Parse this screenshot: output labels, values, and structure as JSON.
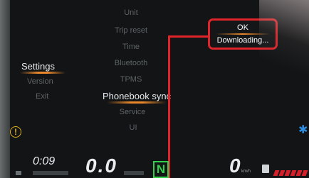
{
  "menu_left": {
    "items": [
      {
        "label": "Settings",
        "active": true
      },
      {
        "label": "Version",
        "active": false
      },
      {
        "label": "Exit",
        "active": false
      }
    ]
  },
  "menu_center": {
    "items": [
      {
        "label": "Unit",
        "active": false
      },
      {
        "label": "Trip reset",
        "active": false
      },
      {
        "label": "Time",
        "active": false
      },
      {
        "label": "Bluetooth",
        "active": false
      },
      {
        "label": "TPMS",
        "active": false
      },
      {
        "label": "Phonebook sync",
        "active": true
      },
      {
        "label": "Service",
        "active": false
      },
      {
        "label": "UI",
        "active": false
      }
    ]
  },
  "popup": {
    "ok_label": "OK",
    "message": "Downloading..."
  },
  "indicators": {
    "warning_icon": "tpms-warning-icon",
    "warning_symbol": "(!)",
    "bluetooth_icon": "bluetooth-icon",
    "bluetooth_symbol": "✱"
  },
  "bottom": {
    "time": "0:09",
    "speed_left": "0.0",
    "gear": "N",
    "speed_right": "0",
    "speed_unit": "km/h"
  },
  "colors": {
    "accent": "#e8882a",
    "annotation": "#e0242a",
    "gear": "#2fd24a",
    "bluetooth": "#2d8de0",
    "warning": "#e0b020"
  }
}
